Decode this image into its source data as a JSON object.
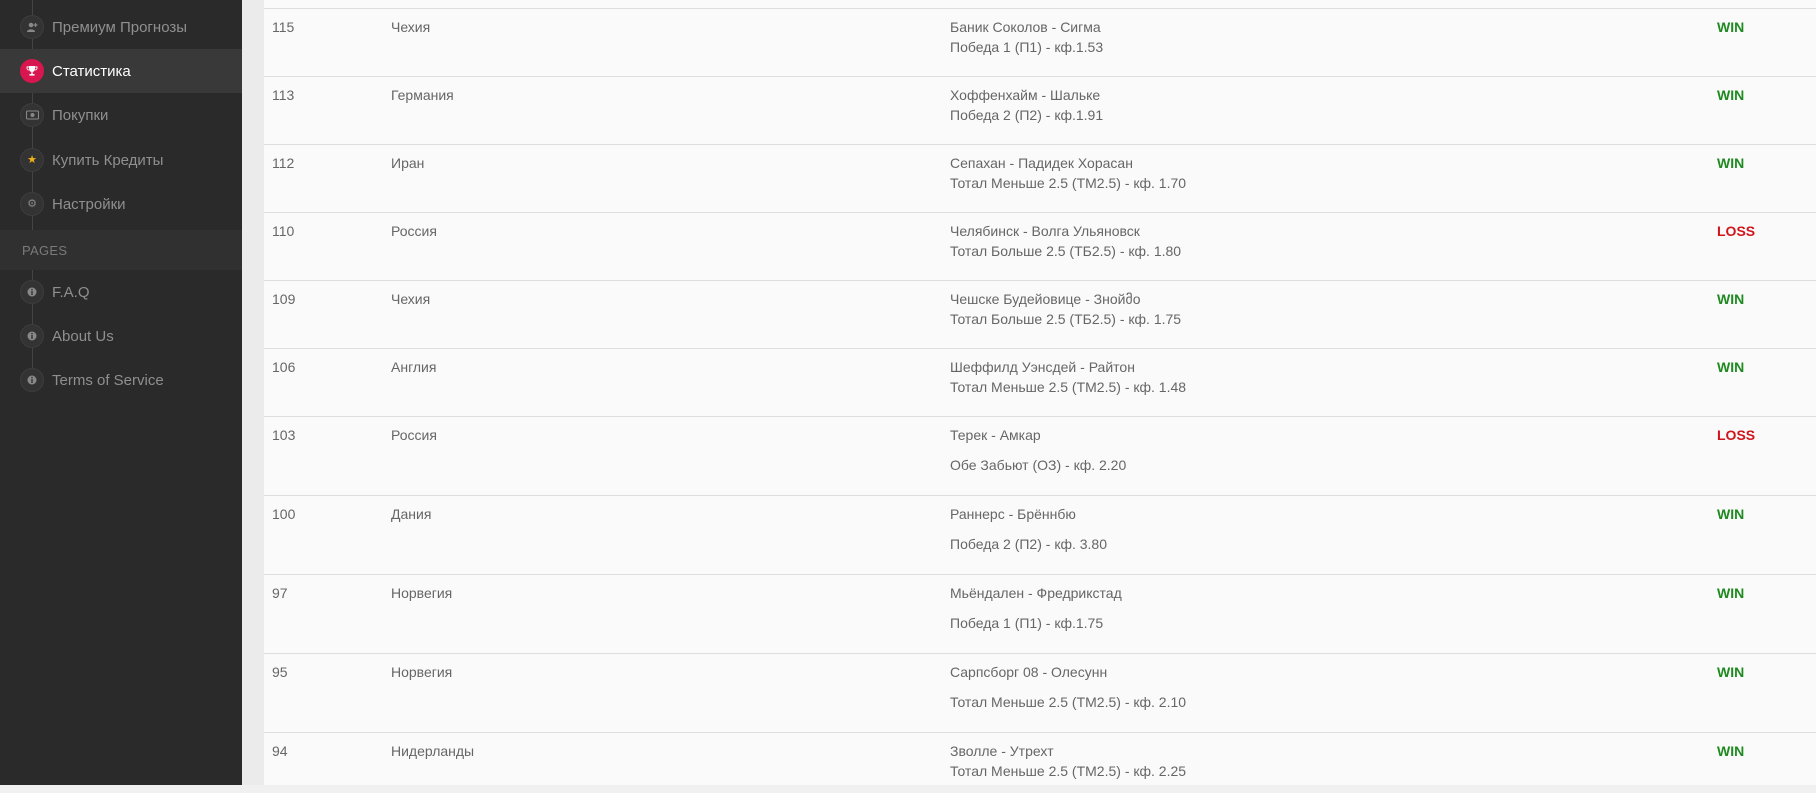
{
  "sidebar": {
    "items": [
      {
        "label": "Премиум Прогнозы",
        "icon": "user-plus-icon",
        "active": false
      },
      {
        "label": "Статистика",
        "icon": "trophy-icon",
        "active": true
      },
      {
        "label": "Покупки",
        "icon": "money-icon",
        "active": false
      },
      {
        "label": "Купить Кредиты",
        "icon": "star-icon",
        "active": false
      },
      {
        "label": "Настройки",
        "icon": "gear-icon",
        "active": false
      }
    ],
    "section_title": "PAGES",
    "pages": [
      {
        "label": "F.A.Q",
        "icon": "info-icon"
      },
      {
        "label": "About Us",
        "icon": "info-icon"
      },
      {
        "label": "Terms of Service",
        "icon": "info-icon"
      }
    ]
  },
  "colors": {
    "win": "#1f8a1f",
    "loss": "#d0151b",
    "accent": "#d8164f"
  },
  "rows": [
    {
      "id": "115",
      "country": "Чехия",
      "match": "Баник Соколов - Сигма",
      "bet": "Победа 1 (П1) - кф.1.53",
      "result": "WIN"
    },
    {
      "id": "113",
      "country": "Германия",
      "match": "Хоффенхайм - Шальке",
      "bet": "Победа 2 (П2) - кф.1.91",
      "result": "WIN"
    },
    {
      "id": "112",
      "country": "Иран",
      "match": "Сепахан - Падидек Хорасан",
      "bet": "Тотал Меньше 2.5 (ТМ2.5) - кф. 1.70",
      "result": "WIN"
    },
    {
      "id": "110",
      "country": "Россия",
      "match": "Челябинск - Волга Ульяновск",
      "bet": "Тотал Больше 2.5 (ТБ2.5) - кф. 1.80",
      "result": "LOSS"
    },
    {
      "id": "109",
      "country": "Чехия",
      "match": "Чешске Будейовице - Знойმо",
      "bet": "Тотал Больше 2.5 (ТБ2.5) - кф. 1.75",
      "result": "WIN"
    },
    {
      "id": "106",
      "country": "Англия",
      "match": "Шеффилд Уэнсдей - Райтон",
      "bet": "Тотал Меньше 2.5 (ТМ2.5) - кф. 1.48",
      "result": "WIN"
    },
    {
      "id": "103",
      "country": "Россия",
      "match": "Терек - Амкар",
      "bet": "Обе Забьют (ОЗ) - кф. 2.20",
      "result": "LOSS"
    },
    {
      "id": "100",
      "country": "Дания",
      "match": "Раннерс - Брённбю",
      "bet": "Победа 2 (П2) - кф. 3.80",
      "result": "WIN"
    },
    {
      "id": "97",
      "country": "Норвегия",
      "match": "Мьёндален - Фредрикстад",
      "bet": "Победа 1 (П1) - кф.1.75",
      "result": "WIN"
    },
    {
      "id": "95",
      "country": "Норвегия",
      "match": "Сарпсборг 08 - Олесунн",
      "bet": "Тотал Меньше 2.5 (ТМ2.5) - кф. 2.10",
      "result": "WIN"
    },
    {
      "id": "94",
      "country": "Нидерланды",
      "match": "Зволле - Утрехт",
      "bet": "Тотал Меньше 2.5 (ТМ2.5) - кф. 2.25",
      "result": "WIN"
    }
  ]
}
